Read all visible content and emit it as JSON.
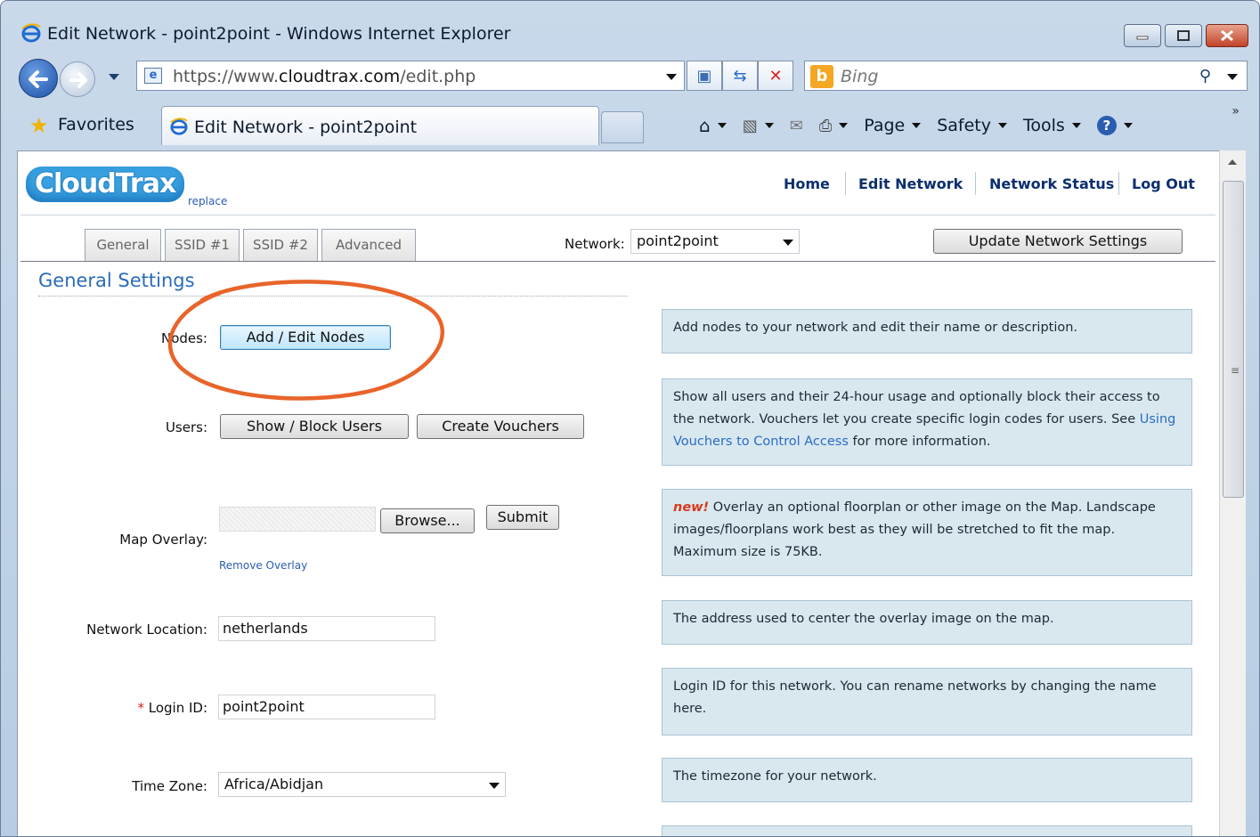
{
  "window": {
    "title": "Edit Network - point2point - Windows Internet Explorer"
  },
  "address_bar": {
    "url_prefix": "https://www.",
    "url_domain": "cloudtrax.com",
    "url_path": "/edit.php"
  },
  "search": {
    "placeholder": "Bing"
  },
  "favorites": {
    "label": "Favorites"
  },
  "tab": {
    "title": "Edit Network - point2point"
  },
  "command_bar": {
    "page": "Page",
    "safety": "Safety",
    "tools": "Tools"
  },
  "site": {
    "logo": "CloudTrax",
    "replace_link": "replace",
    "nav": {
      "home": "Home",
      "edit_network": "Edit Network",
      "network_status": "Network Status",
      "log_out": "Log Out"
    }
  },
  "tabs": {
    "general": "General",
    "ssid1": "SSID #1",
    "ssid2": "SSID #2",
    "advanced": "Advanced"
  },
  "network_selector": {
    "label": "Network:",
    "value": "point2point"
  },
  "update_button": "Update Network Settings",
  "section_title": "General Settings",
  "form": {
    "nodes": {
      "label": "Nodes:",
      "button": "Add / Edit Nodes"
    },
    "users": {
      "label": "Users:",
      "show_block": "Show / Block Users",
      "vouchers": "Create Vouchers"
    },
    "map_overlay": {
      "label": "Map Overlay:",
      "browse": "Browse...",
      "submit": "Submit",
      "remove": "Remove Overlay"
    },
    "network_location": {
      "label": "Network Location:",
      "value": "netherlands"
    },
    "login_id": {
      "required_mark": "*",
      "label": "Login ID:",
      "value": "point2point"
    },
    "time_zone": {
      "label": "Time Zone:",
      "value": "Africa/Abidjan"
    }
  },
  "help": {
    "nodes": "Add nodes to your network and edit their name or description.",
    "users_text": "Show all users and their 24-hour usage and optionally block their access to the network.  Vouchers let you create specific login codes for users. See",
    "users_link": "Using Vouchers to Control Access",
    "users_tail": "for more information.",
    "overlay_new": "new!",
    "overlay_text": "Overlay an optional floorplan or other image on the Map. Landscape images/floorplans work best as they will be stretched to fit the map. Maximum size is 75KB.",
    "location": "The address used to center the overlay image on the map.",
    "login": "Login ID for this network. You can rename networks by changing the name here.",
    "timezone": "The timezone for your network."
  },
  "colors": {
    "accent": "#2a6cb8",
    "help_bg": "#d9e8ef",
    "annotation": "#e8642a"
  }
}
